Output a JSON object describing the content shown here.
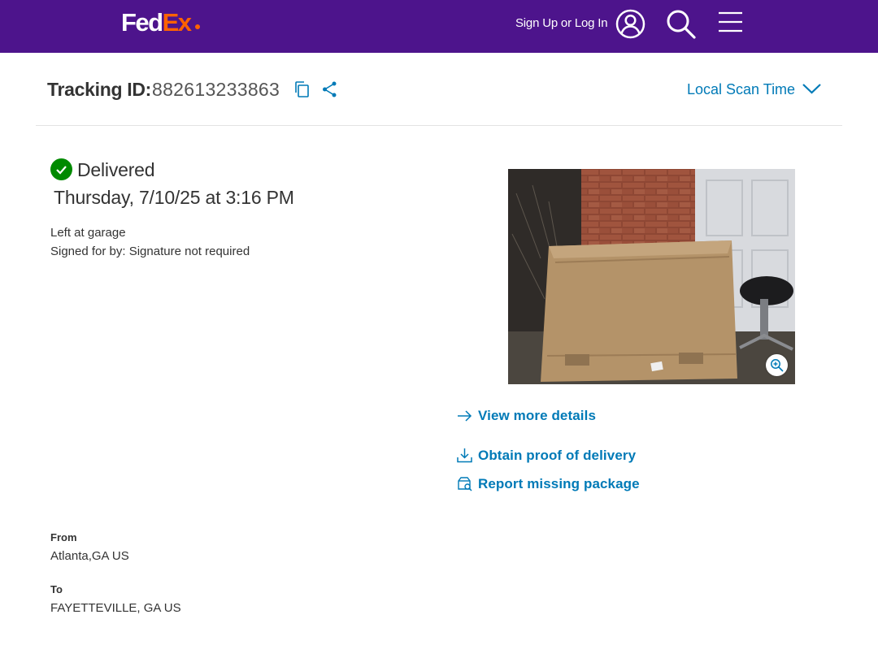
{
  "header": {
    "logo_fed": "Fed",
    "logo_ex": "Ex",
    "signin_label": "Sign Up or Log In"
  },
  "tracking": {
    "label": "Tracking ID:",
    "id": "882613233863",
    "scan_time_label": "Local Scan Time"
  },
  "status": {
    "title": "Delivered",
    "date": "Thursday, 7/10/25 at 3:16 PM",
    "location_note": "Left at garage",
    "signature_note": "Signed for by: Signature not required"
  },
  "actions": {
    "view_details": "View more details",
    "proof_of_delivery": "Obtain proof of delivery",
    "report_missing": "Report missing package"
  },
  "shipment": {
    "from_label": "From",
    "from_value": "Atlanta,GA US",
    "to_label": "To",
    "to_value": "FAYETTEVILLE, GA US"
  },
  "icons": {
    "user": "user-circle-icon",
    "search": "search-icon",
    "menu": "hamburger-menu-icon",
    "copy": "copy-icon",
    "share": "share-icon",
    "chevron": "chevron-down-icon",
    "check": "check-circle-icon",
    "zoom": "zoom-in-icon",
    "arrow": "arrow-right-icon",
    "download": "download-icon",
    "report": "package-search-icon"
  },
  "colors": {
    "header_bg": "#4d148c",
    "brand_orange": "#ff6200",
    "link_blue": "#007ab7",
    "success_green": "#008a00",
    "text": "#333333"
  }
}
